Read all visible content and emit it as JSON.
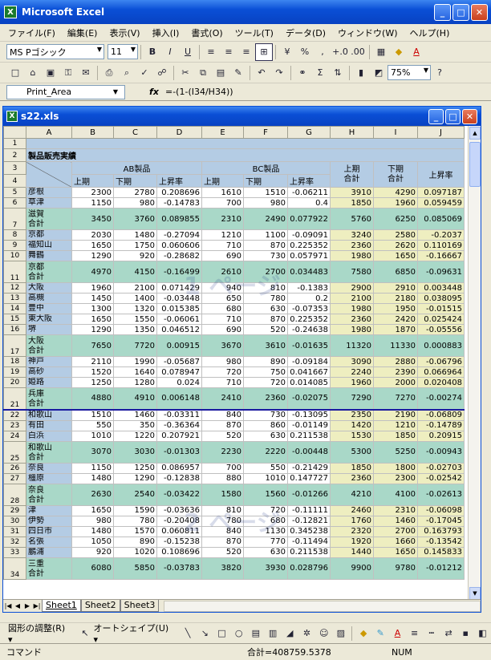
{
  "window": {
    "title": "Microsoft Excel"
  },
  "menu": [
    "ファイル(F)",
    "編集(E)",
    "表示(V)",
    "挿入(I)",
    "書式(O)",
    "ツール(T)",
    "データ(D)",
    "ウィンドウ(W)",
    "ヘルプ(H)"
  ],
  "toolbar": {
    "font": "MS Pゴシック",
    "size": "11",
    "zoom": "75%"
  },
  "formula_bar": {
    "name": "Print_Area",
    "fx": "fx",
    "formula": "=-(1-(I34/H34))"
  },
  "workbook": {
    "title": "s22.xls"
  },
  "columns": [
    "A",
    "B",
    "C",
    "D",
    "E",
    "F",
    "G",
    "H",
    "I",
    "J"
  ],
  "sheet": {
    "title": "製品販売実績",
    "group_ab": "AB製品",
    "group_bc": "BC製品",
    "h_first": "上期",
    "h_second": "下期",
    "h_rate": "上昇率",
    "h_first_total": "上期\n合計",
    "h_second_total": "下期\n合計",
    "h_rate2": "上昇率",
    "rows": [
      {
        "n": "5",
        "a": "彦根",
        "v": [
          "2300",
          "2780",
          "0.208696",
          "1610",
          "1510",
          "-0.06211",
          "3910",
          "4290",
          "0.097187"
        ]
      },
      {
        "n": "6",
        "a": "草津",
        "v": [
          "1150",
          "980",
          "-0.14783",
          "700",
          "980",
          "0.4",
          "1850",
          "1960",
          "0.059459"
        ]
      },
      {
        "n": "7",
        "a": "滋賀\n合計",
        "t": true,
        "v": [
          "3450",
          "3760",
          "0.089855",
          "2310",
          "2490",
          "0.077922",
          "5760",
          "6250",
          "0.085069"
        ]
      },
      {
        "n": "8",
        "a": "京都",
        "v": [
          "2030",
          "1480",
          "-0.27094",
          "1210",
          "1100",
          "-0.09091",
          "3240",
          "2580",
          "-0.2037"
        ]
      },
      {
        "n": "9",
        "a": "福知山",
        "v": [
          "1650",
          "1750",
          "0.060606",
          "710",
          "870",
          "0.225352",
          "2360",
          "2620",
          "0.110169"
        ]
      },
      {
        "n": "10",
        "a": "舞鶴",
        "v": [
          "1290",
          "920",
          "-0.28682",
          "690",
          "730",
          "0.057971",
          "1980",
          "1650",
          "-0.16667"
        ]
      },
      {
        "n": "11",
        "a": "京都\n合計",
        "t": true,
        "v": [
          "4970",
          "4150",
          "-0.16499",
          "2610",
          "2700",
          "0.034483",
          "7580",
          "6850",
          "-0.09631"
        ]
      },
      {
        "n": "12",
        "a": "大阪",
        "v": [
          "1960",
          "2100",
          "0.071429",
          "940",
          "810",
          "-0.1383",
          "2900",
          "2910",
          "0.003448"
        ]
      },
      {
        "n": "13",
        "a": "高槻",
        "v": [
          "1450",
          "1400",
          "-0.03448",
          "650",
          "780",
          "0.2",
          "2100",
          "2180",
          "0.038095"
        ]
      },
      {
        "n": "14",
        "a": "豊中",
        "v": [
          "1300",
          "1320",
          "0.015385",
          "680",
          "630",
          "-0.07353",
          "1980",
          "1950",
          "-0.01515"
        ]
      },
      {
        "n": "15",
        "a": "東大阪",
        "v": [
          "1650",
          "1550",
          "-0.06061",
          "710",
          "870",
          "0.225352",
          "2360",
          "2420",
          "0.025424"
        ]
      },
      {
        "n": "16",
        "a": "堺",
        "v": [
          "1290",
          "1350",
          "0.046512",
          "690",
          "520",
          "-0.24638",
          "1980",
          "1870",
          "-0.05556"
        ]
      },
      {
        "n": "17",
        "a": "大阪\n合計",
        "t": true,
        "v": [
          "7650",
          "7720",
          "0.00915",
          "3670",
          "3610",
          "-0.01635",
          "11320",
          "11330",
          "0.000883"
        ]
      },
      {
        "n": "18",
        "a": "神戸",
        "v": [
          "2110",
          "1990",
          "-0.05687",
          "980",
          "890",
          "-0.09184",
          "3090",
          "2880",
          "-0.06796"
        ]
      },
      {
        "n": "19",
        "a": "高砂",
        "v": [
          "1520",
          "1640",
          "0.078947",
          "720",
          "750",
          "0.041667",
          "2240",
          "2390",
          "0.066964"
        ]
      },
      {
        "n": "20",
        "a": "姫路",
        "v": [
          "1250",
          "1280",
          "0.024",
          "710",
          "720",
          "0.014085",
          "1960",
          "2000",
          "0.020408"
        ]
      },
      {
        "n": "21",
        "a": "兵庫\n合計",
        "t": true,
        "v": [
          "4880",
          "4910",
          "0.006148",
          "2410",
          "2360",
          "-0.02075",
          "7290",
          "7270",
          "-0.00274"
        ]
      },
      {
        "n": "22",
        "a": "和歌山",
        "v": [
          "1510",
          "1460",
          "-0.03311",
          "840",
          "730",
          "-0.13095",
          "2350",
          "2190",
          "-0.06809"
        ]
      },
      {
        "n": "23",
        "a": "有田",
        "v": [
          "550",
          "350",
          "-0.36364",
          "870",
          "860",
          "-0.01149",
          "1420",
          "1210",
          "-0.14789"
        ]
      },
      {
        "n": "24",
        "a": "白浜",
        "v": [
          "1010",
          "1220",
          "0.207921",
          "520",
          "630",
          "0.211538",
          "1530",
          "1850",
          "0.20915"
        ]
      },
      {
        "n": "25",
        "a": "和歌山\n合計",
        "t": true,
        "v": [
          "3070",
          "3030",
          "-0.01303",
          "2230",
          "2220",
          "-0.00448",
          "5300",
          "5250",
          "-0.00943"
        ]
      },
      {
        "n": "26",
        "a": "奈良",
        "v": [
          "1150",
          "1250",
          "0.086957",
          "700",
          "550",
          "-0.21429",
          "1850",
          "1800",
          "-0.02703"
        ]
      },
      {
        "n": "27",
        "a": "橿原",
        "v": [
          "1480",
          "1290",
          "-0.12838",
          "880",
          "1010",
          "0.147727",
          "2360",
          "2300",
          "-0.02542"
        ]
      },
      {
        "n": "28",
        "a": "奈良\n合計",
        "t": true,
        "v": [
          "2630",
          "2540",
          "-0.03422",
          "1580",
          "1560",
          "-0.01266",
          "4210",
          "4100",
          "-0.02613"
        ]
      },
      {
        "n": "29",
        "a": "津",
        "v": [
          "1650",
          "1590",
          "-0.03636",
          "810",
          "720",
          "-0.11111",
          "2460",
          "2310",
          "-0.06098"
        ]
      },
      {
        "n": "30",
        "a": "伊勢",
        "v": [
          "980",
          "780",
          "-0.20408",
          "780",
          "680",
          "-0.12821",
          "1760",
          "1460",
          "-0.17045"
        ]
      },
      {
        "n": "31",
        "a": "四日市",
        "v": [
          "1480",
          "1570",
          "0.060811",
          "840",
          "1130",
          "0.345238",
          "2320",
          "2700",
          "0.163793"
        ]
      },
      {
        "n": "32",
        "a": "名張",
        "v": [
          "1050",
          "890",
          "-0.15238",
          "870",
          "770",
          "-0.11494",
          "1920",
          "1660",
          "-0.13542"
        ]
      },
      {
        "n": "33",
        "a": "鵬浦",
        "v": [
          "920",
          "1020",
          "0.108696",
          "520",
          "630",
          "0.211538",
          "1440",
          "1650",
          "0.145833"
        ]
      },
      {
        "n": "34",
        "a": "三重\n合計",
        "t": true,
        "v": [
          "6080",
          "5850",
          "-0.03783",
          "3820",
          "3930",
          "0.028796",
          "9900",
          "9780",
          "-0.01212"
        ]
      }
    ]
  },
  "sheets": [
    "Sheet1",
    "Sheet2",
    "Sheet3"
  ],
  "drawbar": {
    "adjust": "図形の調整(R) ▾",
    "autoshape": "オートシェイプ(U) ▾"
  },
  "status": {
    "left": "コマンド",
    "sum": "合計=408759.5378",
    "num": "NUM"
  },
  "watermarks": [
    "1 ページ",
    "2 ページ"
  ]
}
